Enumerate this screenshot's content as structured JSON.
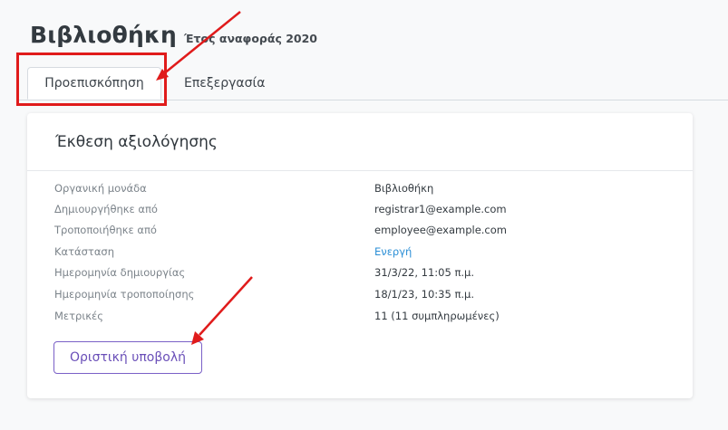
{
  "header": {
    "title": "Βιβλιοθήκη",
    "subtitle": "Έτος αναφοράς 2020"
  },
  "tabs": [
    {
      "label": "Προεπισκόπηση",
      "active": true
    },
    {
      "label": "Επεξεργασία",
      "active": false
    }
  ],
  "card": {
    "title": "Έκθεση αξιολόγησης",
    "rows": [
      {
        "label": "Οργανική μονάδα",
        "value": "Βιβλιοθήκη"
      },
      {
        "label": "Δημιουργήθηκε από",
        "value": "registrar1@example.com"
      },
      {
        "label": "Τροποποιήθηκε από",
        "value": "employee@example.com"
      },
      {
        "label": "Κατάσταση",
        "value": "Ενεργή"
      },
      {
        "label": "Ημερομηνία δημιουργίας",
        "value": "31/3/22, 11:05 π.μ."
      },
      {
        "label": "Ημερομηνία τροποποίησης",
        "value": "18/1/23, 10:35 π.μ."
      },
      {
        "label": "Μετρικές",
        "value": "11 (11 συμπληρωμένες)"
      }
    ],
    "submit_label": "Οριστική υποβολή"
  },
  "colors": {
    "annotation": "#e01b1b",
    "status": "#2b8fd6",
    "button": "#6a4fb8"
  }
}
